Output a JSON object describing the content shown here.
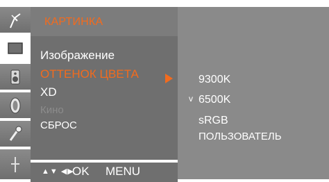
{
  "colors": {
    "accent": "#f26b1e",
    "panel": "#6f6f6f",
    "title_bar": "#7c7c7c",
    "submenu": "#8a8a8a"
  },
  "sidebar": {
    "icons": [
      {
        "name": "antenna-icon",
        "glyph": "✈"
      },
      {
        "name": "screen-icon",
        "glyph": "□"
      },
      {
        "name": "speaker-icon",
        "glyph": "◎"
      },
      {
        "name": "timer-icon",
        "glyph": "⊘"
      },
      {
        "name": "key-icon",
        "glyph": "⚷"
      },
      {
        "name": "input-icon",
        "glyph": "↑"
      }
    ]
  },
  "menu": {
    "title": "КАРТИНКА",
    "items": [
      {
        "label": "Изображение"
      },
      {
        "label": "ОТТЕНОК ЦВЕТА"
      },
      {
        "label": "XD"
      },
      {
        "label": "Кино"
      },
      {
        "label": "СБРОС"
      }
    ]
  },
  "hint": {
    "arrows": "▲▼ ◀▶",
    "ok": "OK",
    "menu": "MENU"
  },
  "submenu": {
    "check_mark": "v",
    "items": [
      {
        "label": "9300K"
      },
      {
        "label": "6500K"
      },
      {
        "label": "sRGB"
      },
      {
        "label": "ПОЛЬЗОВАТЕЛЬ"
      }
    ]
  }
}
